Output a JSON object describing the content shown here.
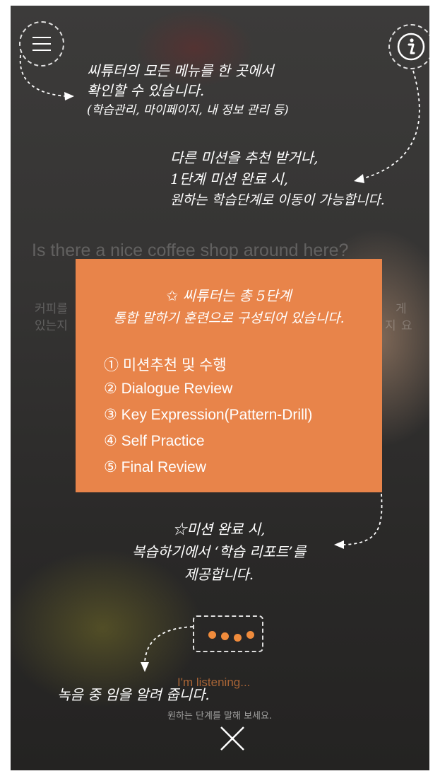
{
  "colors": {
    "overlay": "#333231",
    "accent_orange": "#e8844a",
    "dot_orange": "#f08b3c",
    "text_white": "#ffffff"
  },
  "header": {
    "menu_icon": "hamburger-menu-icon",
    "info_icon": "info-icon"
  },
  "background": {
    "sentence_en": "Is there a nice coffee shop around here?",
    "sentence_ko_1": "커피를",
    "sentence_ko_1b": "게",
    "sentence_ko_2": "있는지",
    "sentence_ko_2b": "지",
    "sentence_ko_2c": "요",
    "listening": "I'm listening...",
    "hint": "원하는 단계를 말해 보세요."
  },
  "coach": {
    "menu_tip": [
      "씨튜터의 모든 메뉴를 한 곳에서",
      "확인할 수 있습니다.",
      "(학습관리, 마이페이지, 내 정보 관리 등)"
    ],
    "info_tip": [
      "다른 미션을 추천 받거나,",
      "1단계 미션 완료 시,",
      "원하는 학습단계로 이동이 가능합니다."
    ],
    "steps_title": [
      "씨튜터는 총 5단계",
      "통합 말하기 훈련으로 구성되어 있습니다."
    ],
    "steps": [
      "① 미션추천 및 수행",
      "② Dialogue Review",
      "③ Key Expression(Pattern-Drill)",
      "④ Self Practice",
      "⑤ Final Review"
    ],
    "report_tip": [
      "☆미션 완료 시,",
      "복습하기에서 ‘학습 리포트’를",
      "제공합니다."
    ],
    "recording_tip": "녹음 중 임을 알려 줍니다."
  },
  "close": {
    "icon": "close-icon"
  }
}
